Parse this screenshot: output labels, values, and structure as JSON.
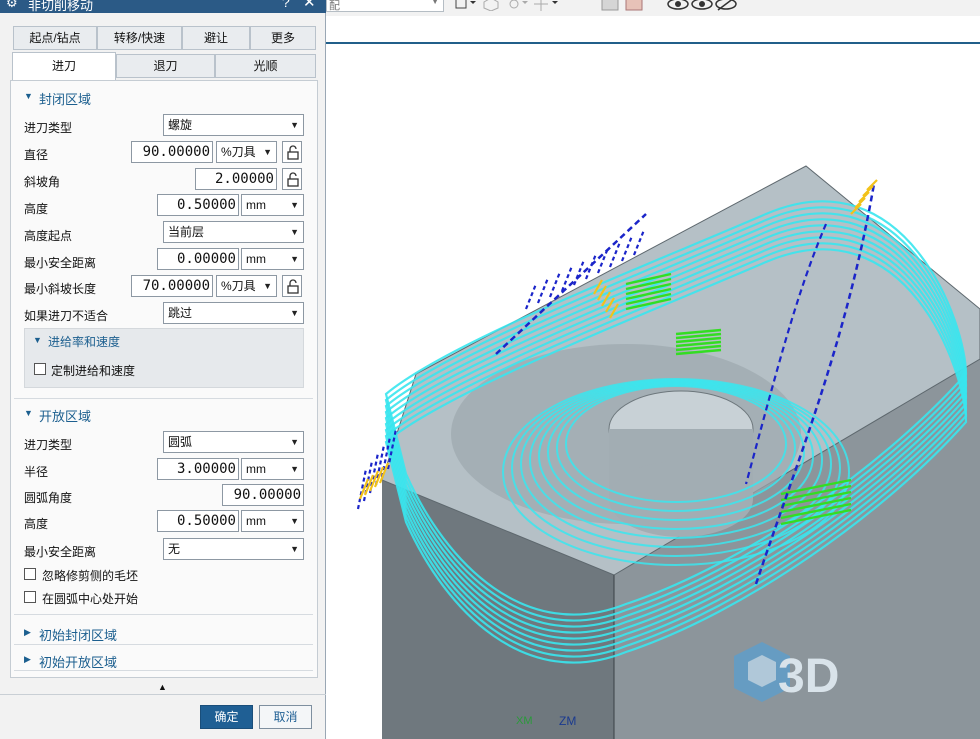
{
  "dialog": {
    "title": "非切削移动",
    "help_glyph": "?",
    "close_glyph": "✕",
    "tabs_row1": [
      "起点/钻点",
      "转移/快速",
      "避让",
      "更多"
    ],
    "tabs_row2": [
      "进刀",
      "退刀",
      "光顺"
    ],
    "active_tab": "进刀",
    "closed_area": {
      "header": "封闭区域",
      "entry_type_label": "进刀类型",
      "entry_type_value": "螺旋",
      "diameter_label": "直径",
      "diameter_value": "90.00000",
      "diameter_unit": "%刀具",
      "ramp_angle_label": "斜坡角",
      "ramp_angle_value": "2.00000",
      "height_label": "高度",
      "height_value": "0.50000",
      "height_unit": "mm",
      "height_from_label": "高度起点",
      "height_from_value": "当前层",
      "min_safe_label": "最小安全距离",
      "min_safe_value": "0.00000",
      "min_safe_unit": "mm",
      "min_ramp_label": "最小斜坡长度",
      "min_ramp_value": "70.00000",
      "min_ramp_unit": "%刀具",
      "if_not_fit_label": "如果进刀不适合",
      "if_not_fit_value": "跳过",
      "feed_section_header": "进给率和速度",
      "custom_feed_label": "定制进给和速度"
    },
    "open_area": {
      "header": "开放区域",
      "entry_type_label": "进刀类型",
      "entry_type_value": "圆弧",
      "radius_label": "半径",
      "radius_value": "3.00000",
      "radius_unit": "mm",
      "arc_angle_label": "圆弧角度",
      "arc_angle_value": "90.00000",
      "height_label": "高度",
      "height_value": "0.50000",
      "height_unit": "mm",
      "min_safe_label": "最小安全距离",
      "min_safe_value": "无",
      "ignore_trim_label": "忽略修剪侧的毛坯",
      "start_at_center_label": "在圆弧中心处开始"
    },
    "initial_closed_header": "初始封闭区域",
    "initial_open_header": "初始开放区域",
    "ok_label": "确定",
    "cancel_label": "取消"
  },
  "toolbar": {
    "partial_text": "配"
  },
  "viewport": {
    "axis_label_1": "XM",
    "axis_label_2": "ZM",
    "watermark_text": "3D",
    "colors": {
      "cyan_path": "#39e6ee",
      "green_path": "#33dd22",
      "blue_rapid": "#1b25c9",
      "yellow_path": "#f2c21a",
      "block_top": "#a9b3b9",
      "block_front": "#7d878d",
      "watermark": "#5a9fcf"
    }
  }
}
